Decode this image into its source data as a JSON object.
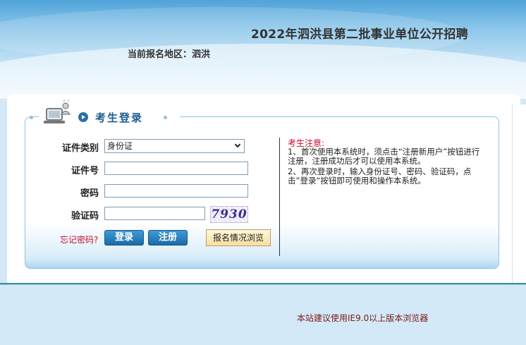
{
  "header": {
    "title": "2022年泗洪县第二批事业单位公开招聘",
    "region_label": "当前报名地区：泗洪"
  },
  "login": {
    "panel_title": "考生登录",
    "id_type_label": "证件类别",
    "id_type_value": "身份证",
    "id_number_label": "证件号",
    "id_number_value": "",
    "password_label": "密码",
    "password_value": "",
    "captcha_label": "验证码",
    "captcha_value": "",
    "captcha_image_text": "7930",
    "forgot_password": "忘记密码?",
    "login_button": "登录",
    "register_button": "注册",
    "browse_button": "报名情况浏览"
  },
  "notice": {
    "title": "考生注意:",
    "item1": "1、首次使用本系统时，须点击“注册新用户”按钮进行注册，注册成功后才可以使用本系统。",
    "item2": "2、再次登录时，输入身份证号、密码、验证码，点击”登录“按钮即可使用和操作本系统。"
  },
  "footer": {
    "browser_note": "本站建议使用IE9.0以上版本浏览器"
  },
  "colors": {
    "accent_blue": "#1c6aa6",
    "warning_red": "#c8102e",
    "header_blue": "#4fa3d9"
  }
}
